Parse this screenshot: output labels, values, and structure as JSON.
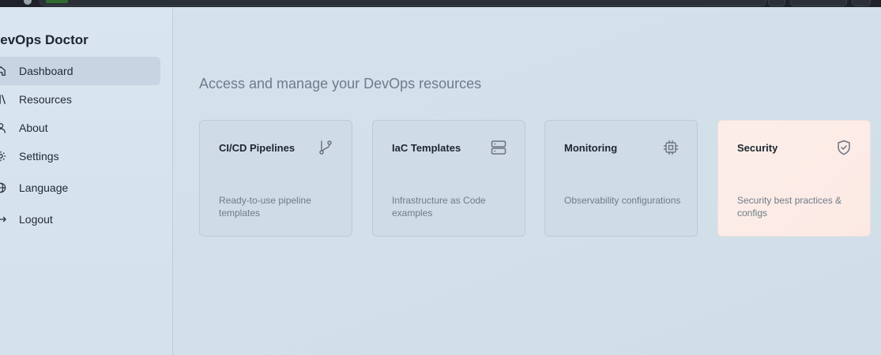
{
  "app": {
    "title": "DevOps Doctor"
  },
  "sidebar": {
    "items": [
      {
        "label": "Dashboard",
        "icon": "home-icon",
        "active": true
      },
      {
        "label": "Resources",
        "icon": "library-icon",
        "active": false
      },
      {
        "label": "About",
        "icon": "user-icon",
        "active": false
      },
      {
        "label": "Settings",
        "icon": "gear-icon",
        "active": false
      },
      {
        "label": "Language",
        "icon": "globe-icon",
        "active": false
      },
      {
        "label": "Logout",
        "icon": "logout-icon",
        "active": false
      }
    ]
  },
  "main": {
    "subtitle": "Access and manage your DevOps resources",
    "cards": [
      {
        "title": "CI/CD Pipelines",
        "description": "Ready-to-use pipeline templates",
        "icon": "git-branch-icon",
        "highlighted": false
      },
      {
        "title": "IaC Templates",
        "description": "Infrastructure as Code examples",
        "icon": "server-icon",
        "highlighted": false
      },
      {
        "title": "Monitoring",
        "description": "Observability configurations",
        "icon": "cpu-icon",
        "highlighted": false
      },
      {
        "title": "Security",
        "description": "Security best practices & configs",
        "icon": "shield-check-icon",
        "highlighted": true
      }
    ]
  },
  "colors": {
    "background": "#d3e0ea",
    "active_nav": "#c7d5e2",
    "highlight_card": "#fbeee9",
    "text_primary": "#1d2530",
    "text_muted": "#6f7c89"
  }
}
